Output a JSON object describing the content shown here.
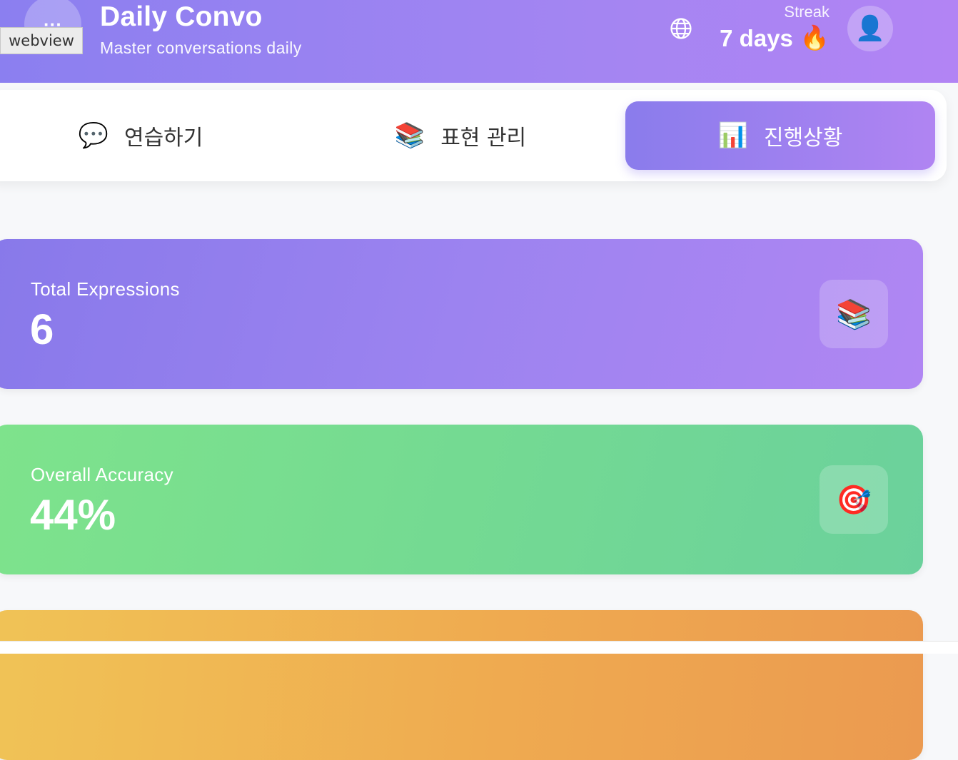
{
  "header": {
    "logo_glyph": "···",
    "webview_label": "webview",
    "title": "Daily Convo",
    "subtitle": "Master conversations daily",
    "streak_label": "Streak",
    "streak_value": "7 days",
    "streak_emoji": "🔥",
    "globe_icon": "globe-icon",
    "avatar_icon": "user-icon",
    "avatar_glyph": "👤"
  },
  "tabs": [
    {
      "icon": "💬",
      "label": "연습하기",
      "active": false
    },
    {
      "icon": "📚",
      "label": "표현 관리",
      "active": false
    },
    {
      "icon": "📊",
      "label": "진행상황",
      "active": true
    }
  ],
  "stats": [
    {
      "label": "Total Expressions",
      "value": "6",
      "icon": "📚",
      "color": "#9a82ef"
    },
    {
      "label": "Overall Accuracy",
      "value": "44%",
      "icon": "🎯",
      "color": "#76dc92"
    },
    {
      "label": "",
      "value": "",
      "icon": "",
      "color": "#efab50"
    }
  ]
}
